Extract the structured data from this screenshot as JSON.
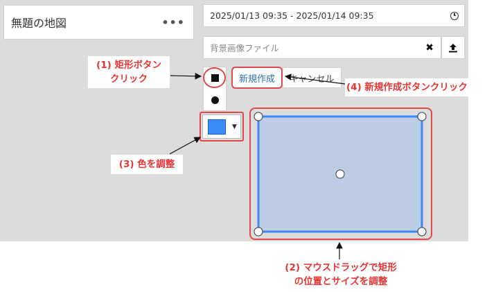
{
  "map": {
    "title": "無題の地図",
    "menu_label": "•••",
    "time_range": "2025/01/13 09:35 - 2025/01/14 09:35",
    "bg_image_placeholder": "背景画像ファイル",
    "clear_label": "✖"
  },
  "tools": {
    "new_label": "新規作成",
    "cancel_label": "キャンセル",
    "color": "#3a8af8"
  },
  "annotations": {
    "step1_line1": "(1) 矩形ボタン",
    "step1_line2": "クリック",
    "step2_line1": "(2) マウスドラッグで矩形",
    "step2_line2": "の位置とサイズを調整",
    "step3": "(3) 色を調整",
    "step4": "(4) 新規作成ボタンクリック",
    "accent_color": "#e04848"
  }
}
